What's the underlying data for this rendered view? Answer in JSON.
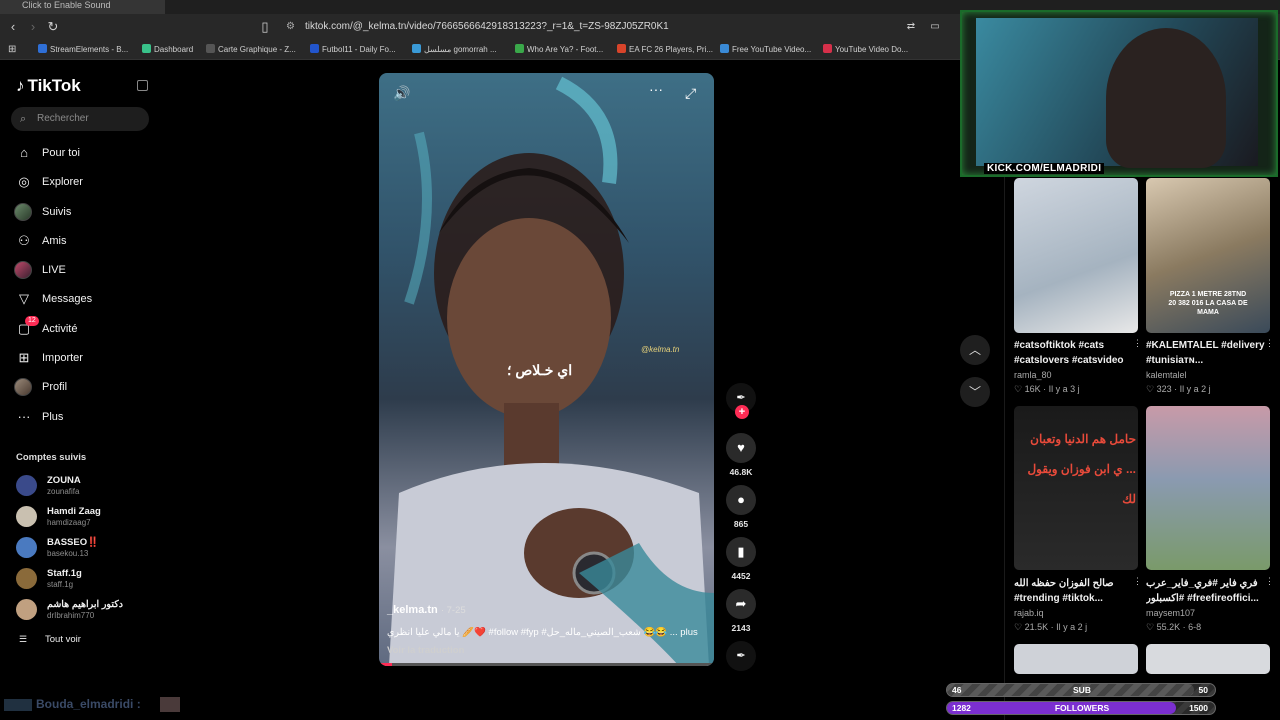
{
  "browser": {
    "tab_title": "Click to Enable Sound",
    "url": "tiktok.com/@_kelma.tn/video/7666566642918313223?_r=1&_t=ZS-98ZJ05ZR0K1",
    "bookmarks": [
      {
        "label": "StreamElements - B...",
        "color": "#2f6fd6"
      },
      {
        "label": "Dashboard",
        "color": "#39c28a"
      },
      {
        "label": "Carte Graphique - Z...",
        "color": "#555555"
      },
      {
        "label": "Futbol11 - Daily Fo...",
        "color": "#2255cc"
      },
      {
        "label": "مسلسل gomorrah ...",
        "color": "#3a9ad6"
      },
      {
        "label": "Who Are Ya? - Foot...",
        "color": "#3aa84a"
      },
      {
        "label": "EA FC 26 Players, Pri...",
        "color": "#d8442a"
      },
      {
        "label": "Free YouTube Video...",
        "color": "#3a8ad6"
      },
      {
        "label": "YouTube Video Do...",
        "color": "#d6304a"
      }
    ]
  },
  "sidebar": {
    "logo": "TikTok",
    "search_placeholder": "Rechercher",
    "nav": [
      {
        "label": "Pour toi",
        "icon": "home-icon"
      },
      {
        "label": "Explorer",
        "icon": "compass-icon"
      },
      {
        "label": "Suivis",
        "icon": "avatar"
      },
      {
        "label": "Amis",
        "icon": "friends-icon"
      },
      {
        "label": "LIVE",
        "icon": "avatar"
      },
      {
        "label": "Messages",
        "icon": "send-icon"
      },
      {
        "label": "Activité",
        "icon": "bell-icon",
        "badge": "12"
      },
      {
        "label": "Importer",
        "icon": "plus-box-icon"
      },
      {
        "label": "Profil",
        "icon": "avatar"
      },
      {
        "label": "Plus",
        "icon": "more-icon"
      }
    ],
    "following_title": "Comptes suivis",
    "following": [
      {
        "name": "ZOUNA",
        "handle": "zounafifa",
        "color": "#3a4a8a"
      },
      {
        "name": "Hamdi Zaag",
        "handle": "hamdizaag7",
        "color": "#c9c0b0"
      },
      {
        "name": "BASSEO‼️",
        "handle": "basekou.13",
        "color": "#4a7ac0"
      },
      {
        "name": "Staff.1g",
        "handle": "staff.1g",
        "color": "#8a6a3a"
      },
      {
        "name": "دكتور ابراهيم هاشم",
        "handle": "drIbrahim770",
        "color": "#c0a080"
      }
    ],
    "see_all": "Tout voir"
  },
  "chat_overlay": {
    "text": "Bouda_elmadridi :"
  },
  "video": {
    "caption_arabic": "اي خـلاص ؛",
    "watermark": "@kelma.tn",
    "author": "_kelma.tn",
    "date": "· 7-25",
    "description": "يا مالي عليا انظري 🥖❤️ #follow #fyp #شعب_الصيني_ماله_حل 😂😂 ...  plus",
    "translate": "Voir la traduction",
    "progress": 0.04
  },
  "actions": {
    "likes": "46.8K",
    "comments": "865",
    "saves": "4452",
    "shares": "2143"
  },
  "recommended": [
    {
      "text": "#catsoftiktok #cats #catslovers #catsvideo",
      "user": "ramla_80",
      "likes": "16K",
      "time": "Il y a 3 j",
      "bg": "linear-gradient(160deg,#cfd6df,#a5b3c0 60%,#e8e8e8)"
    },
    {
      "text": "#KALEMTALEL #delivery #tunisiaᴛɴ...",
      "user": "kalemtalel",
      "likes": "323",
      "time": "Il y a 2 j",
      "bg": "linear-gradient(160deg,#d8c8b0,#8a7a60 50%,#3a4a5a)",
      "overlay": "PIZZA 1 METRE 28TND 20 382 016 LA CASA DE MAMA"
    },
    {
      "text": "صالح الفوزان حفظه الله #trending #tiktok...",
      "user": "rajab.iq",
      "likes": "21.5K",
      "time": "Il y a 2 j",
      "bg": "linear-gradient(180deg,#1a1a1a,#2a2a2a)",
      "overlay": "حامل هم الدنيا وتعبان ... ي ابن فوزان ويقول لك"
    },
    {
      "text": "فري فاير #فري_فاير_عرب #اكسبلور #freefireoffici...",
      "user": "maysem107",
      "likes": "55.2K",
      "time": "6-8",
      "bg": "linear-gradient(180deg,#c89aa8,#8a9ab0 45%,#7a9a6a)"
    }
  ],
  "stream_overlay": {
    "webcam_label": "KICK.COM/ELMADRIDI",
    "sub_bar": {
      "current": "46",
      "label": "SUB",
      "goal": "50",
      "progress": 0.92
    },
    "followers_bar": {
      "current": "1282",
      "label": "FOLLOWERS",
      "goal": "1500",
      "progress": 0.855
    }
  }
}
